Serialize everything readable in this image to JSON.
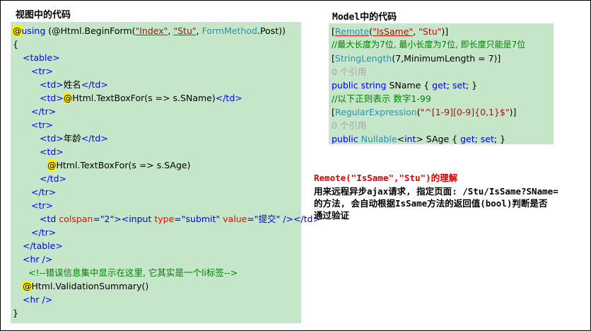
{
  "view_section": {
    "title": "视图中的代码"
  },
  "view_code": {
    "l1_at": "@",
    "l1_using": "using",
    "l1_a": " (@Html.BeginForm(",
    "l1_index": "\"Index\"",
    "l1_comma1": ", ",
    "l1_stu": "\"Stu\"",
    "l1_comma2": ", ",
    "l1_formmethod": "FormMethod",
    "l1_post": ".Post))",
    "l2": "{",
    "l3": "<table>",
    "l4": "<tr>",
    "l5_open": "<td>",
    "l5_text": "姓名",
    "l5_close": "</td>",
    "l6_open": "<td>",
    "l6_at": "@",
    "l6_code": "Html.TextBoxFor(s => s.SName)",
    "l6_close": "</td>",
    "l7": "</tr>",
    "l8": "<tr>",
    "l9_open": "<td>",
    "l9_text": "年龄",
    "l9_close": "</td>",
    "l10": "<td>",
    "l11_at": "@",
    "l11_code": "Html.TextBoxFor(s => s.SAge)",
    "l12": "</td>",
    "l13": "</tr>",
    "l14": "<tr>",
    "l15_td": "<td ",
    "l15_colspan": "colspan",
    "l15_eq1": "=",
    "l15_colspan_val": "\"2\"",
    "l15_input": "><input ",
    "l15_type": "type",
    "l15_eq2": "=",
    "l15_type_val": "\"submit\"",
    "l15_value": " value",
    "l15_eq3": "=",
    "l15_value_val": "\"提交\"",
    "l15_end": " /></td>",
    "l16": "</tr>",
    "l17": "</table>",
    "l18": "<hr />",
    "l19": "<!--错误信息集中显示在这里, 它其实是一个li标签-->",
    "l20_at": "@",
    "l20_code": "Html.ValidationSummary()",
    "l21": "<hr />",
    "l22": "}"
  },
  "model_section": {
    "title": "Model中的代码"
  },
  "model_code": {
    "m1_open": "[",
    "m1_remote": "Remote",
    "m1_paren": "(",
    "m1_issame": "\"IsSame\"",
    "m1_comma": ", ",
    "m1_stu": "\"Stu\"",
    "m1_close": ")]",
    "m2": "//最大长度为7位, 最小长度为7位, 即长度只能是7位",
    "m3_open": "[",
    "m3_strlen": "StringLength",
    "m3_rest": "(7,MinimumLength = 7)]",
    "m4": "0 个引用",
    "m5_public": "public",
    "m5_string": " string",
    "m5_name": " SName { ",
    "m5_get": "get",
    "m5_semi": "; ",
    "m5_set": "set",
    "m5_end": "; }",
    "m6": "//以下正则表示 数字1-99",
    "m7_open": "[",
    "m7_regex": "RegularExpression",
    "m7_paren": "(",
    "m7_pattern": "\"^[1-9][0-9]{0,1}$\"",
    "m7_close": ")]",
    "m8": "0 个引用",
    "m9_public": "public",
    "m9_nullable": " Nullable",
    "m9_lt": "<",
    "m9_int": "int",
    "m9_name": "> SAge { ",
    "m9_get": "get",
    "m9_semi": "; ",
    "m9_set": "set",
    "m9_end": "; }"
  },
  "explanation": {
    "heading": "Remote(\"IsSame\",\"Stu\")的理解",
    "line1": "用来远程异步ajax请求, 指定页面: /Stu/IsSame?SName=",
    "line2": "的方法, 会自动根据IsSame方法的返回值(bool)判断是否",
    "line3": "通过验证"
  },
  "colors": {
    "panel_bg": "#c6e6c9",
    "keyword": "#0000ff",
    "string": "#a31515",
    "type": "#2b91af",
    "attribute": "#ff0000",
    "tag": "#800000",
    "comment": "#008000",
    "razor_highlight": "#ffee00",
    "heading_red": "#e00000"
  }
}
